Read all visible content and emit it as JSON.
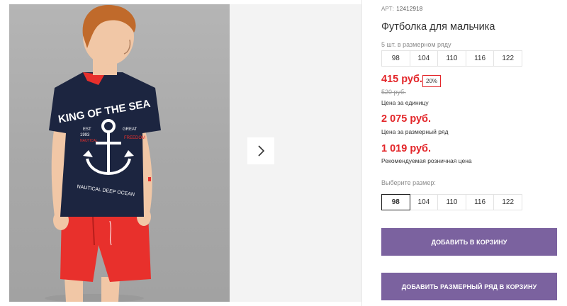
{
  "product": {
    "sku_label": "АРТ:",
    "sku": "12412918",
    "title": "Футболка для мальчика",
    "row_info": "5 шт. в размерном ряду",
    "row_sizes": [
      "98",
      "104",
      "110",
      "116",
      "122"
    ],
    "price": "415 руб.",
    "discount": "20%",
    "old_price": "520 руб.",
    "price_caption": "Цена за единицу",
    "row_price": "2 075 руб.",
    "row_price_caption": "Цена за размерный ряд",
    "retail_price": "1 019 руб.",
    "retail_price_caption": "Рекомендуемая розничная цена",
    "choose_size_label": "Выберите размер:",
    "size_options": [
      "98",
      "104",
      "110",
      "116",
      "122"
    ],
    "selected_size": "98"
  },
  "buttons": {
    "add_to_cart": "ДОБАВИТЬ В КОРЗИНУ",
    "add_row_to_cart": "ДОБАВИТЬ РАЗМЕРНЫЙ РЯД В КОРЗИНУ"
  },
  "image_text": {
    "shirt_line1": "KING OF THE SEA",
    "shirt_line2": "NAUTICAL DEEP OCEAN"
  },
  "colors": {
    "accent_price": "#e3262a",
    "button_bg": "#7b629f",
    "shirt": "#1c2540",
    "shorts": "#e8302c"
  },
  "icons": {
    "gallery_next": "chevron-right-icon"
  }
}
